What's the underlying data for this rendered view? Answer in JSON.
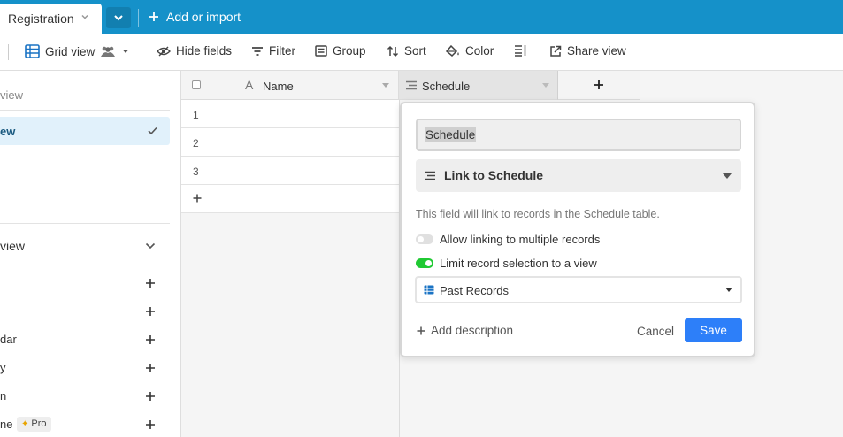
{
  "topbar": {
    "table_tab": "Registration",
    "add_import": "Add or import"
  },
  "toolbar": {
    "view_name": "Grid view",
    "hide_fields": "Hide fields",
    "filter": "Filter",
    "group": "Group",
    "sort": "Sort",
    "color": "Color",
    "share_view": "Share view"
  },
  "sidebar": {
    "find_view_partial": "view",
    "selected_view_partial": "ew",
    "create_section_partial": "view",
    "create_items": [
      "",
      "",
      "dar",
      "y",
      "n",
      "ne"
    ],
    "pro_badge": "Pro"
  },
  "grid": {
    "columns": [
      "Name",
      "Schedule"
    ],
    "rows": [
      "1",
      "2",
      "3"
    ]
  },
  "popup": {
    "field_name": "Schedule",
    "field_type": "Link to Schedule",
    "description": "This field will link to records in the Schedule table.",
    "option_multiple": "Allow linking to multiple records",
    "option_multiple_on": false,
    "option_limit": "Limit record selection to a view",
    "option_limit_on": true,
    "view_select": "Past Records",
    "add_description": "Add description",
    "cancel": "Cancel",
    "save": "Save"
  },
  "colors": {
    "topbar": "#1591c9",
    "save_button": "#2d7ff9",
    "toggle_on": "#20c933",
    "selected_view_bg": "#e1f1fb"
  }
}
